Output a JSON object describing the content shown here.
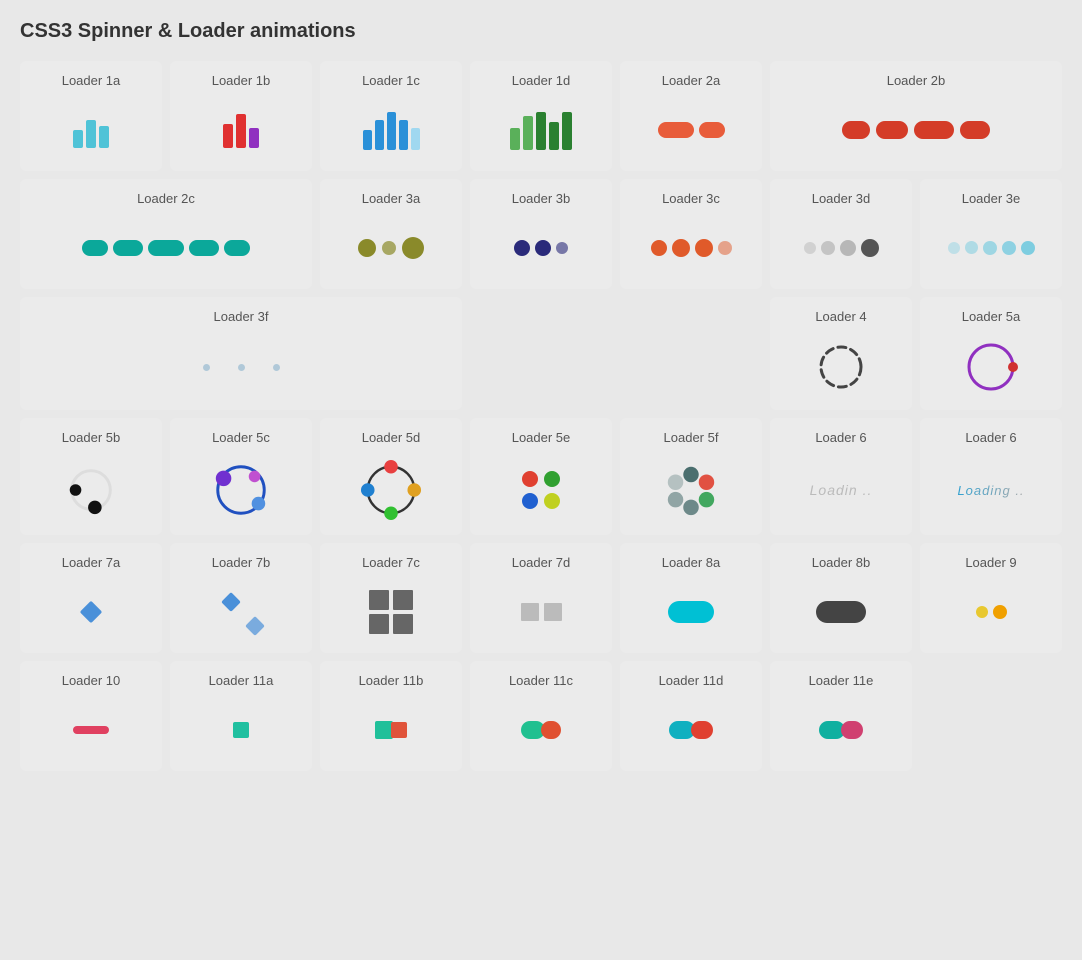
{
  "page": {
    "title": "CSS3 Spinner & Loader animations"
  },
  "loaders": {
    "loader1a": {
      "label": "Loader 1a"
    },
    "loader1b": {
      "label": "Loader 1b"
    },
    "loader1c": {
      "label": "Loader 1c"
    },
    "loader1d": {
      "label": "Loader 1d"
    },
    "loader2a": {
      "label": "Loader 2a"
    },
    "loader2b": {
      "label": "Loader 2b"
    },
    "loader2c": {
      "label": "Loader 2c"
    },
    "loader3a": {
      "label": "Loader 3a"
    },
    "loader3b": {
      "label": "Loader 3b"
    },
    "loader3c": {
      "label": "Loader 3c"
    },
    "loader3d": {
      "label": "Loader 3d"
    },
    "loader3e": {
      "label": "Loader 3e"
    },
    "loader3f": {
      "label": "Loader 3f"
    },
    "loader4": {
      "label": "Loader 4"
    },
    "loader5a": {
      "label": "Loader 5a"
    },
    "loader5b": {
      "label": "Loader 5b"
    },
    "loader5c": {
      "label": "Loader 5c"
    },
    "loader5d": {
      "label": "Loader 5d"
    },
    "loader5e": {
      "label": "Loader 5e"
    },
    "loader5f": {
      "label": "Loader 5f"
    },
    "loader6a": {
      "label": "Loader 6",
      "text": "Loadin .."
    },
    "loader6b": {
      "label": "Loader 6",
      "text": "Loading .."
    },
    "loader7a": {
      "label": "Loader 7a"
    },
    "loader7b": {
      "label": "Loader 7b"
    },
    "loader7c": {
      "label": "Loader 7c"
    },
    "loader7d": {
      "label": "Loader 7d"
    },
    "loader8a": {
      "label": "Loader 8a"
    },
    "loader8b": {
      "label": "Loader 8b"
    },
    "loader9": {
      "label": "Loader 9"
    },
    "loader10": {
      "label": "Loader 10"
    },
    "loader11a": {
      "label": "Loader 11a"
    },
    "loader11b": {
      "label": "Loader 11b"
    },
    "loader11c": {
      "label": "Loader 11c"
    },
    "loader11d": {
      "label": "Loader 11d"
    },
    "loader11e": {
      "label": "Loader 11e"
    }
  }
}
